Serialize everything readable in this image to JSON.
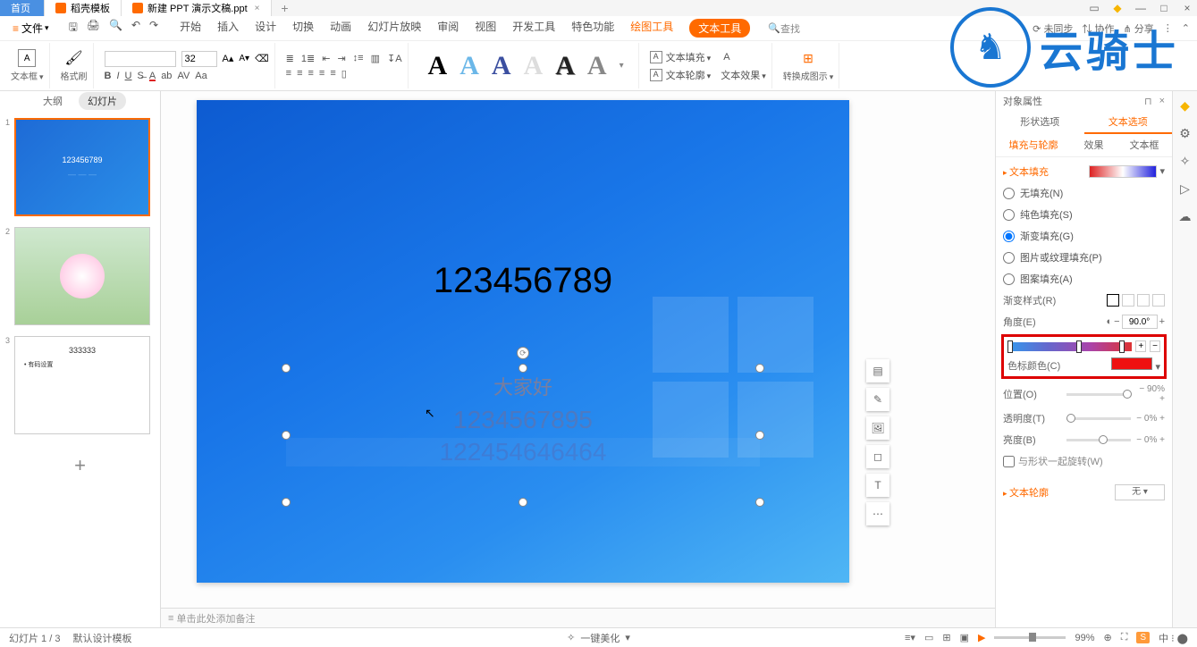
{
  "tabs": {
    "home": "首页",
    "t1": "稻壳模板",
    "t2": "新建 PPT 演示文稿.ppt"
  },
  "menu": {
    "file": "文件",
    "items": [
      "开始",
      "插入",
      "设计",
      "切换",
      "动画",
      "幻灯片放映",
      "审阅",
      "视图",
      "开发工具",
      "特色功能"
    ],
    "draw": "绘图工具",
    "text_tool": "文本工具",
    "search": "查找",
    "unsync": "未同步",
    "collab": "协作",
    "share": "分享"
  },
  "ribbon": {
    "textbox": "文本框",
    "format_painter": "格式刷",
    "font_size": "32",
    "text_fill": "文本填充",
    "text_outline": "文本轮廓",
    "text_effect": "文本效果",
    "convert_smart": "转换成图示"
  },
  "outline": {
    "tab_outline": "大纲",
    "tab_slides": "幻灯片",
    "thumb1_text": "123456789",
    "thumb3_title": "333333",
    "thumb3_line": "• 有码设置"
  },
  "canvas": {
    "big": "123456789",
    "l1": "大家好",
    "l2": "1234567895",
    "l3": "122454646464"
  },
  "notes": "单击此处添加备注",
  "props": {
    "title": "对象属性",
    "tab_shape": "形状选项",
    "tab_text": "文本选项",
    "sub_fill": "填充与轮廓",
    "sub_effect": "效果",
    "sub_box": "文本框",
    "sec_fill": "文本填充",
    "r_none": "无填充(N)",
    "r_solid": "纯色填充(S)",
    "r_grad": "渐变填充(G)",
    "r_pic": "图片或纹理填充(P)",
    "r_pattern": "图案填充(A)",
    "grad_style": "渐变样式(R)",
    "angle": "角度(E)",
    "angle_val": "90.0°",
    "stop_color": "色标颜色(C)",
    "position": "位置(O)",
    "position_val": "90%",
    "transparency": "透明度(T)",
    "transparency_val": "0%",
    "brightness": "亮度(B)",
    "brightness_val": "0%",
    "rotate_with": "与形状一起旋转(W)",
    "sec_outline": "文本轮廓",
    "outline_none": "无"
  },
  "status": {
    "page": "幻灯片 1 / 3",
    "template": "默认设计模板",
    "beautify": "一键美化",
    "zoom": "99%",
    "ime": "S"
  }
}
